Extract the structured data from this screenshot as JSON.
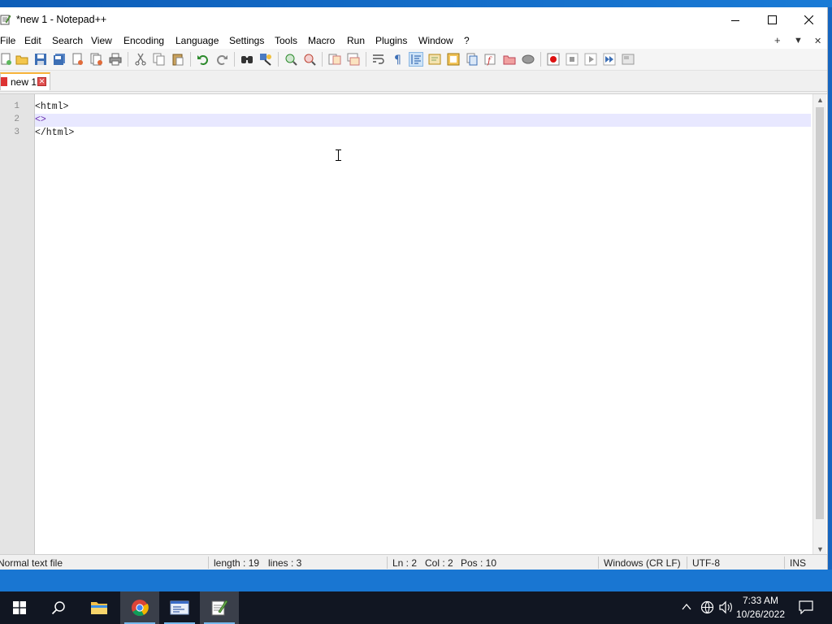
{
  "window": {
    "title": "*new 1 - Notepad++",
    "minimize_icon": "minimize-icon",
    "maximize_icon": "maximize-icon",
    "close_icon": "close-icon"
  },
  "menu": {
    "items": [
      "File",
      "Edit",
      "Search",
      "View",
      "Encoding",
      "Language",
      "Settings",
      "Tools",
      "Macro",
      "Run",
      "Plugins",
      "Window",
      "?"
    ],
    "extras": [
      "+",
      "▼",
      "✕"
    ]
  },
  "tabs": [
    {
      "label": "new 1",
      "modified": true,
      "active": true
    }
  ],
  "editor": {
    "line_numbers": [
      "1",
      "2",
      "3"
    ],
    "lines": [
      "<html>",
      "<>",
      "</html>"
    ],
    "current_line": 2
  },
  "status": {
    "filetype": "Normal text file",
    "length": "length : 19",
    "lines": "lines : 3",
    "ln": "Ln : 2",
    "col": "Col : 2",
    "pos": "Pos : 10",
    "eol": "Windows (CR LF)",
    "encoding": "UTF-8",
    "mode": "INS"
  },
  "taskbar": {
    "time": "7:33 AM",
    "date": "10/26/2022",
    "items": [
      "start-icon",
      "search-icon",
      "file-explorer-icon",
      "chrome-icon",
      "app-window-icon",
      "notepadpp-icon"
    ],
    "tray": [
      "chevron-up-icon",
      "network-icon",
      "volume-icon",
      "notification-icon"
    ]
  },
  "colors": {
    "accent_tab": "#f7b33a",
    "current_line": "#e8e8ff",
    "taskbar": "#111622",
    "desktop": "#1976d2"
  }
}
